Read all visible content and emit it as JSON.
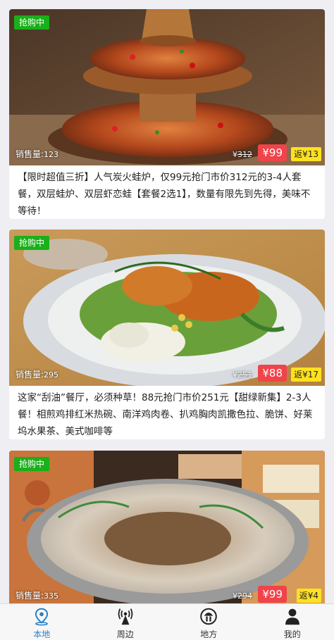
{
  "deals": [
    {
      "tag": "抢购中",
      "sales_label": "销售量:",
      "sales": "123",
      "original_price": "312",
      "price": "99",
      "rebate": "13",
      "title": "【限时超值三折】人气炭火蛙炉，仅99元抢门市价312元的3-4人套餐，双层蛙炉、双层虾恋蛙【套餐2选1】，数量有限先到先得，美味不等待！"
    },
    {
      "tag": "抢购中",
      "sales_label": "销售量:",
      "sales": "295",
      "original_price": "251",
      "price": "88",
      "rebate": "17",
      "title": "这家“刮油”餐厅，必须种草！88元抢门市价251元【甜绿新集】2-3人餐！相煎鸡排红米热碗、南洋鸡肉卷、扒鸡胸肉凯撒色拉、脆饼、好莱坞水果茶、美式咖啡等"
    },
    {
      "tag": "抢购中",
      "sales_label": "销售量:",
      "sales": "335",
      "original_price": "294",
      "price": "99",
      "rebate": "4",
      "title": ""
    }
  ],
  "currency": "¥",
  "rebate_prefix": "返¥",
  "tabbar": [
    {
      "label": "本地",
      "icon": "location-pin-icon",
      "active": true
    },
    {
      "label": "周边",
      "icon": "radio-tower-icon",
      "active": false
    },
    {
      "label": "地方",
      "icon": "hat-face-icon",
      "active": false
    },
    {
      "label": "我的",
      "icon": "user-icon",
      "active": false
    }
  ],
  "colors": {
    "tag_green": "#19b019",
    "price_red": "#f0434a",
    "rebate_yellow": "#ffe11f",
    "active_tab_blue": "#2b7fc6"
  }
}
